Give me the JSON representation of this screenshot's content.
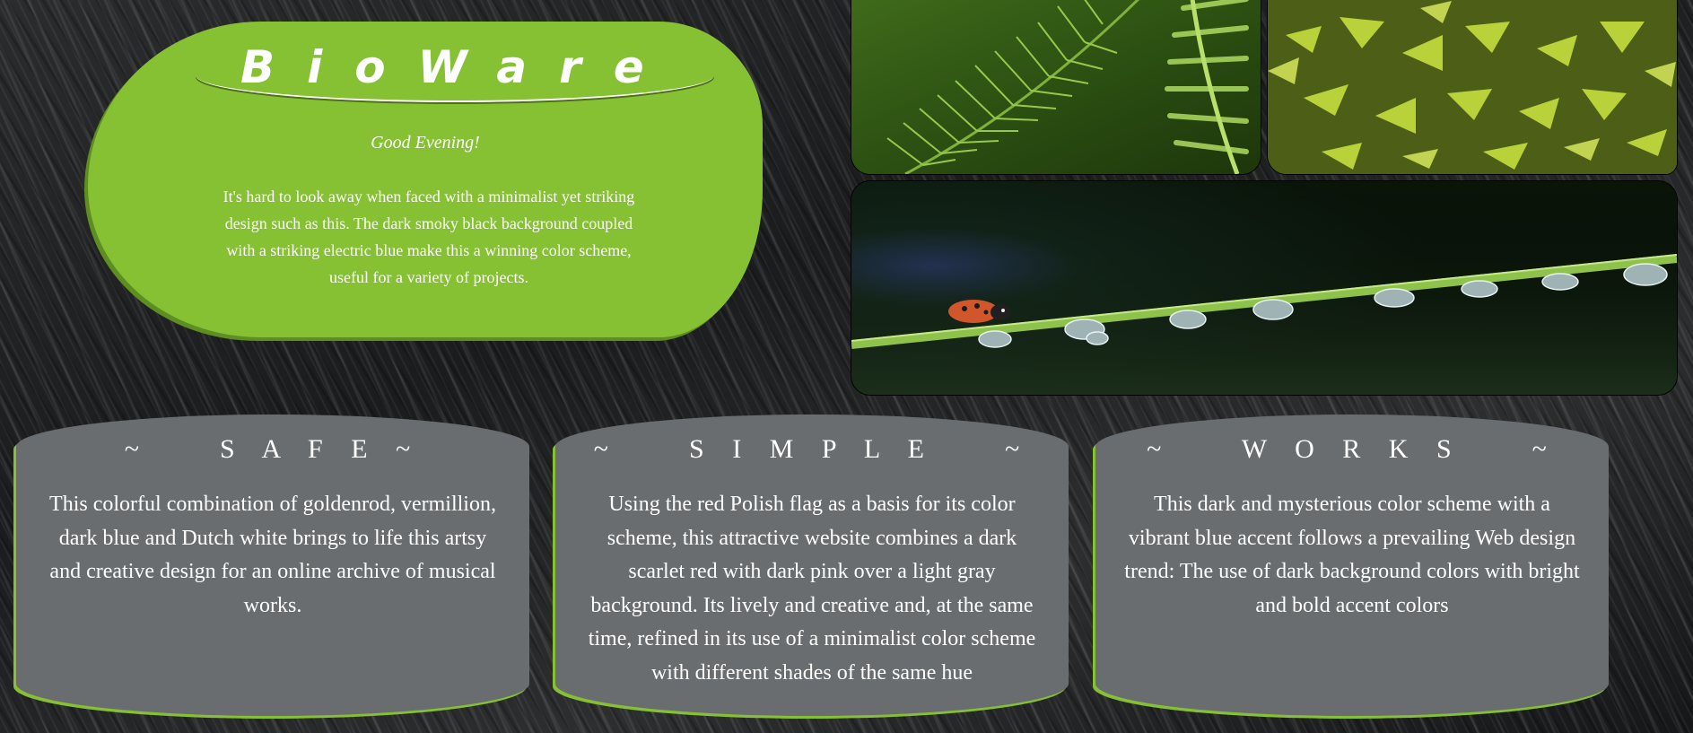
{
  "hero": {
    "brand": "BioWare",
    "greeting": "Good Evening!",
    "intro": "It's hard to look away when faced with a minimalist yet striking design such as this. The dark smoky black background coupled with a striking electric blue make this a winning color scheme, useful for a variety of projects."
  },
  "photos": [
    {
      "subject": "fern"
    },
    {
      "subject": "yellow-green leaves"
    },
    {
      "subject": "ladybug on grass blade with water droplets"
    }
  ],
  "cards": [
    {
      "title": "~    S A F E ~",
      "body": "This colorful combination of goldenrod, vermillion, dark blue and Dutch white brings to life this artsy and creative design for an online archive of musical works."
    },
    {
      "title": "~    S I M P L E    ~",
      "body": "Using the red Polish flag as a basis for its color scheme, this attractive website combines a dark scarlet red with dark pink over a light gray background. Its lively and creative and, at the same time, refined in its use of a minimalist color scheme with different shades of the same hue"
    },
    {
      "title": "~    W O R K S    ~",
      "body": "This dark and mysterious color scheme with a vibrant blue accent follows a prevailing Web design trend: The use of dark background colors with bright and bold accent colors"
    }
  ],
  "colors": {
    "accent": "#86c033",
    "card": "#6a6d70",
    "background": "#1f2021"
  }
}
